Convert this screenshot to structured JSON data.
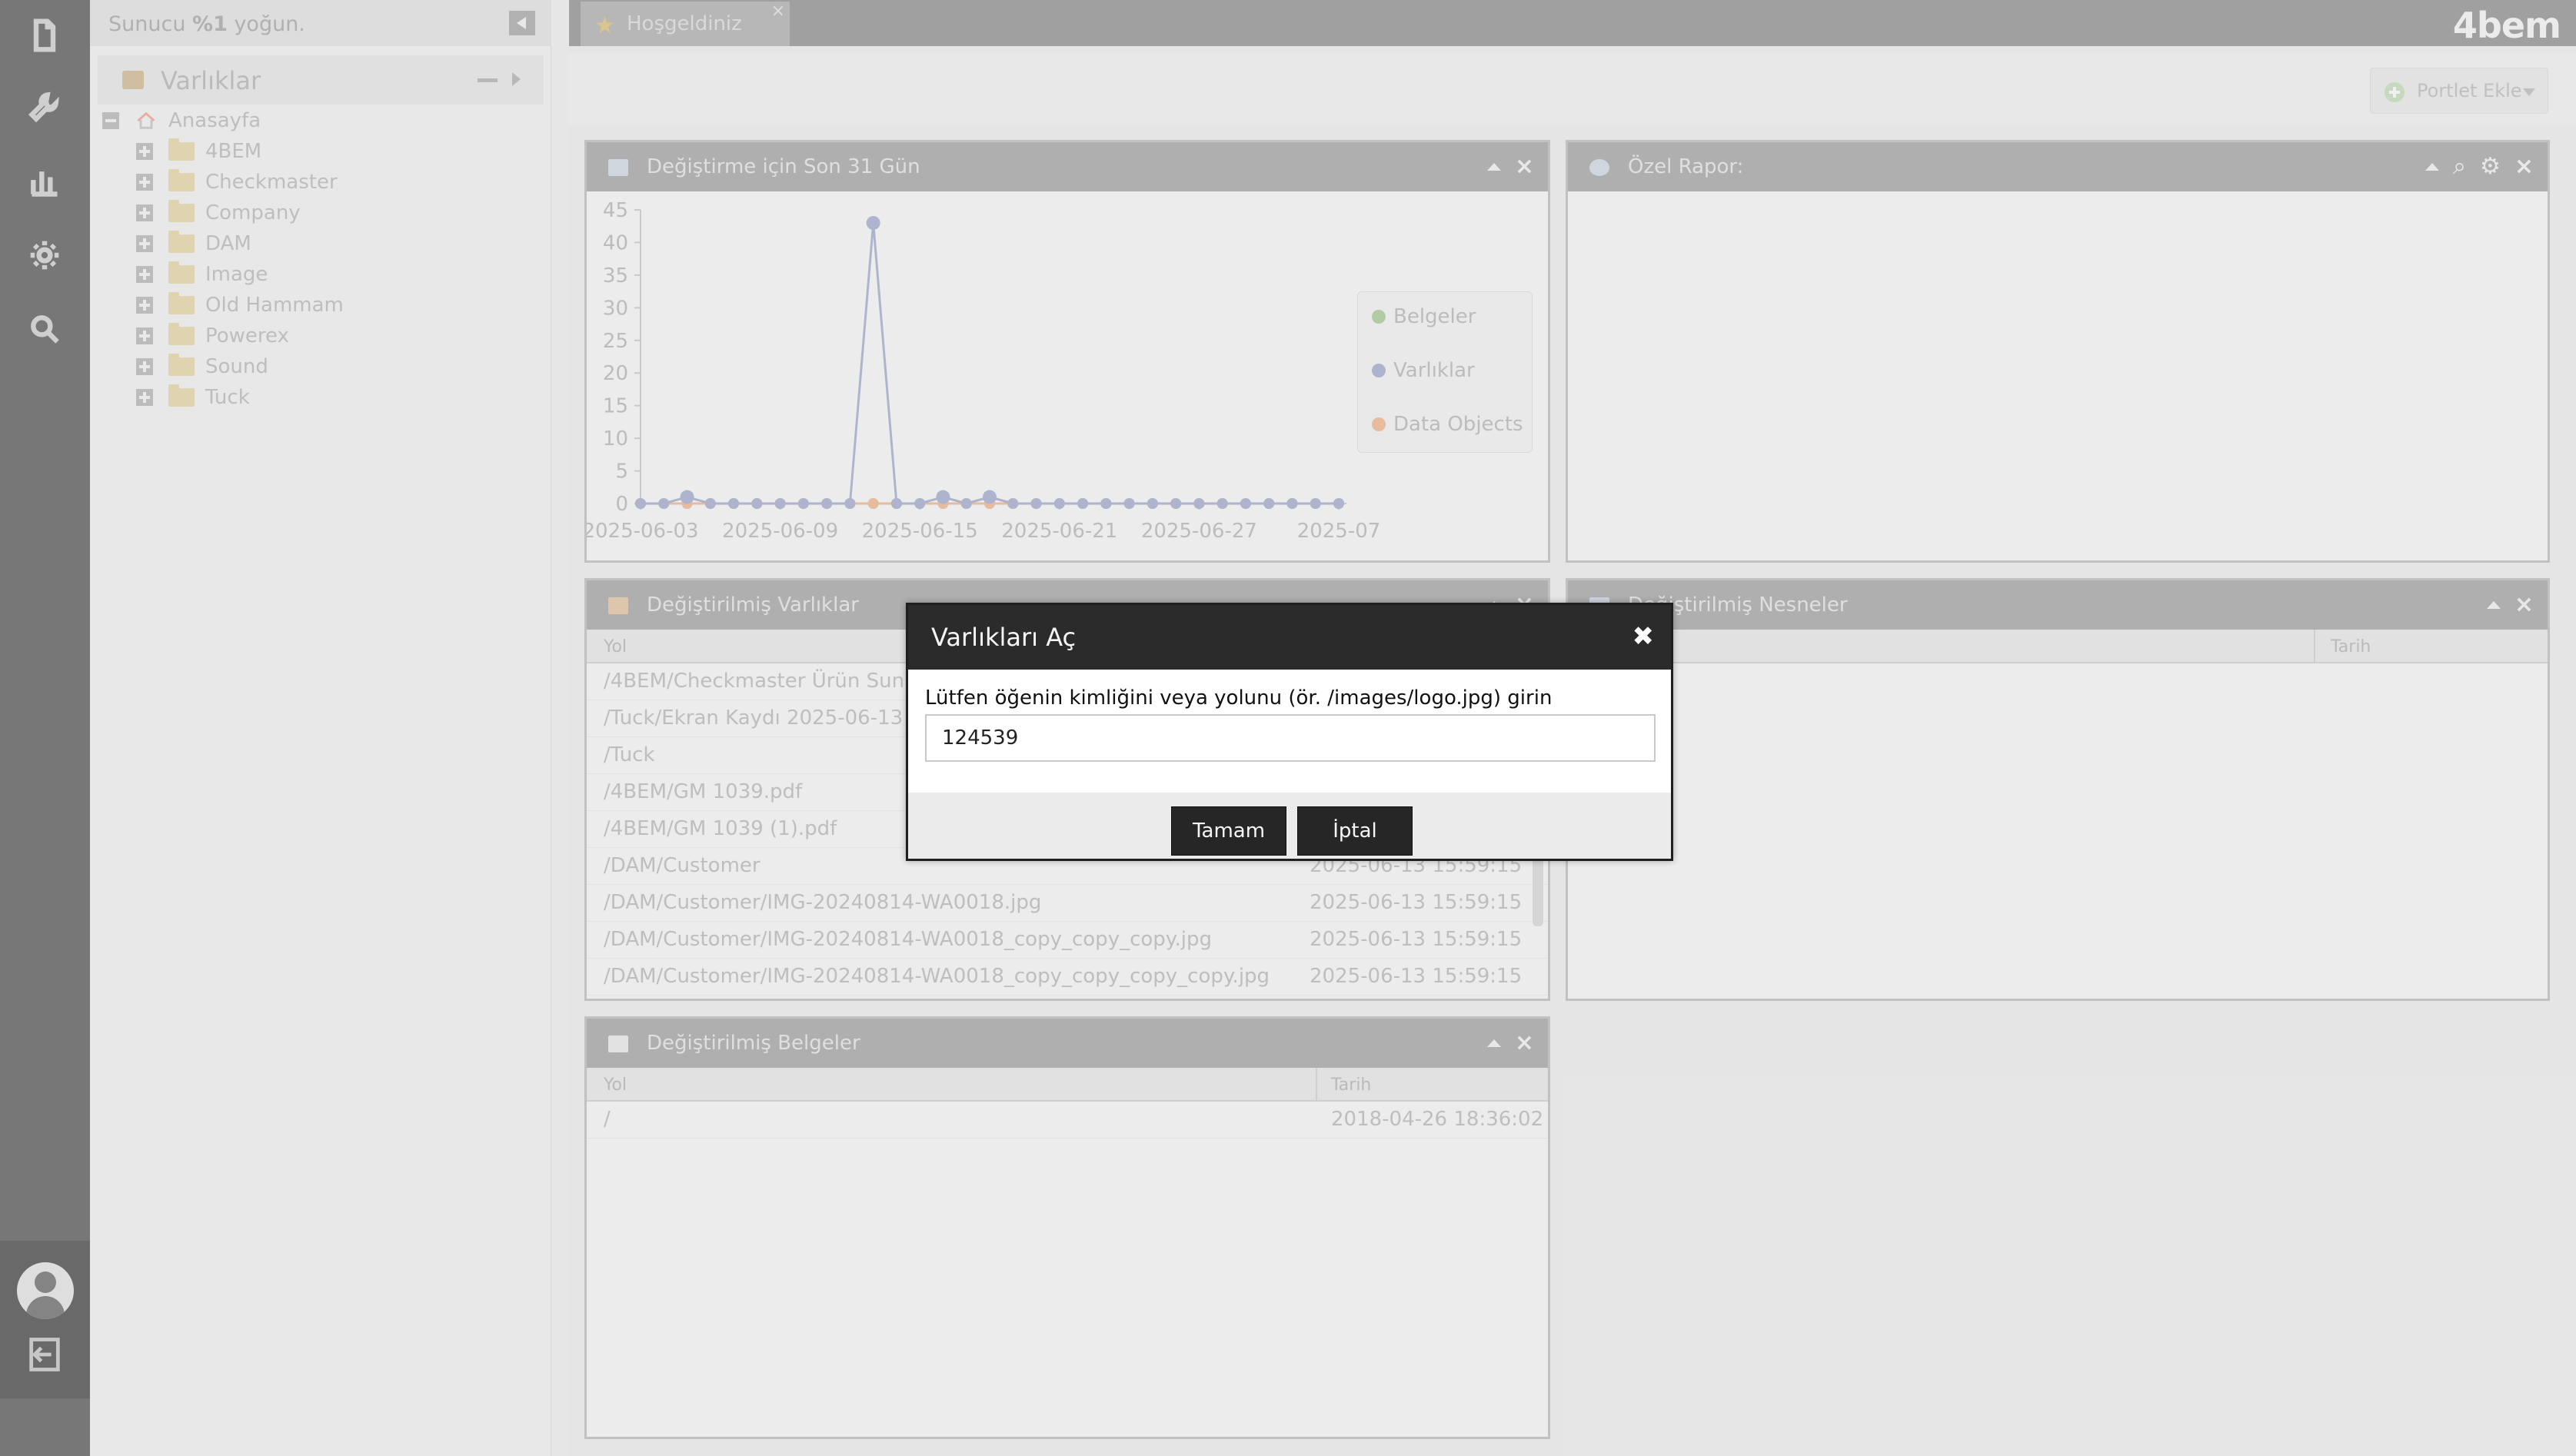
{
  "status": {
    "prefix": "Sunucu ",
    "bold": "%1",
    "suffix": " yoğun."
  },
  "tree": {
    "title": "Varlıklar",
    "root": "Anasayfa",
    "items": [
      "4BEM",
      "Checkmaster",
      "Company",
      "DAM",
      "Image",
      "Old Hammam",
      "Powerex",
      "Sound",
      "Tuck"
    ]
  },
  "tabs": [
    {
      "label": "Hoşgeldiniz"
    }
  ],
  "logo": "4bem",
  "toolbar": {
    "add_portlet": "Portlet Ekle"
  },
  "portlets": {
    "chart": {
      "title": "Değiştirme için Son 31 Gün"
    },
    "report": {
      "title": "Özel Rapor:"
    },
    "assets": {
      "title": "Değiştirilmiş Varlıklar",
      "col_path": "Yol",
      "rows": [
        {
          "path": "/4BEM/Checkmaster Ürün Sunum",
          "date": ""
        },
        {
          "path": "/Tuck/Ekran Kaydı 2025-06-13 19",
          "date": ""
        },
        {
          "path": "/Tuck",
          "date": ""
        },
        {
          "path": "/4BEM/GM 1039.pdf",
          "date": ""
        },
        {
          "path": "/4BEM/GM 1039 (1).pdf",
          "date": ""
        },
        {
          "path": "/DAM/Customer",
          "date": "2025-06-13 15:59:15"
        },
        {
          "path": "/DAM/Customer/IMG-20240814-WA0018.jpg",
          "date": "2025-06-13 15:59:15"
        },
        {
          "path": "/DAM/Customer/IMG-20240814-WA0018_copy_copy_copy.jpg",
          "date": "2025-06-13 15:59:15"
        },
        {
          "path": "/DAM/Customer/IMG-20240814-WA0018_copy_copy_copy_copy.jpg",
          "date": "2025-06-13 15:59:15"
        }
      ]
    },
    "objects": {
      "title": "Değiştirilmiş Nesneler",
      "col_date": "Tarih"
    },
    "documents": {
      "title": "Değiştirilmiş Belgeler",
      "col_path": "Yol",
      "col_date": "Tarih",
      "rows": [
        {
          "path": "/",
          "date": "2018-04-26 18:36:02"
        }
      ]
    }
  },
  "modal": {
    "title": "Varlıkları Aç",
    "prompt": "Lütfen öğenin kimliğini veya yolunu (ör. /images/logo.jpg) girin",
    "input_value": "124539",
    "ok": "Tamam",
    "cancel": "İptal"
  },
  "chart_data": {
    "type": "line",
    "x_tick_labels": [
      "2025-06-03",
      "2025-06-09",
      "2025-06-15",
      "2025-06-21",
      "2025-06-27",
      "2025-07"
    ],
    "y_ticks": [
      0,
      5,
      10,
      15,
      20,
      25,
      30,
      35,
      40,
      45
    ],
    "ylim": [
      0,
      45
    ],
    "grid": false,
    "legend_position": "right",
    "series": [
      {
        "name": "Belgeler",
        "color": "#b9d4ae",
        "values": [
          0,
          0,
          0,
          0,
          0,
          0,
          0,
          0,
          0,
          0,
          0,
          0,
          0,
          0,
          0,
          0,
          0,
          0,
          0,
          0,
          0,
          0,
          0,
          0,
          0,
          0,
          0,
          0,
          0,
          0,
          0
        ]
      },
      {
        "name": "Varlıklar",
        "color": "#b6bcd6",
        "values": [
          0,
          0,
          1,
          0,
          0,
          0,
          0,
          0,
          0,
          0,
          43,
          0,
          0,
          1,
          0,
          1,
          0,
          0,
          0,
          0,
          0,
          0,
          0,
          0,
          0,
          0,
          0,
          0,
          0,
          0,
          0
        ]
      },
      {
        "name": "Data Objects",
        "color": "#f0c3a5",
        "values": [
          0,
          0,
          0,
          0,
          0,
          0,
          0,
          0,
          0,
          0,
          0,
          0,
          0,
          0,
          0,
          0,
          0,
          0,
          0,
          0,
          0,
          0,
          0,
          0,
          0,
          0,
          0,
          0,
          0,
          0,
          0
        ]
      }
    ]
  }
}
